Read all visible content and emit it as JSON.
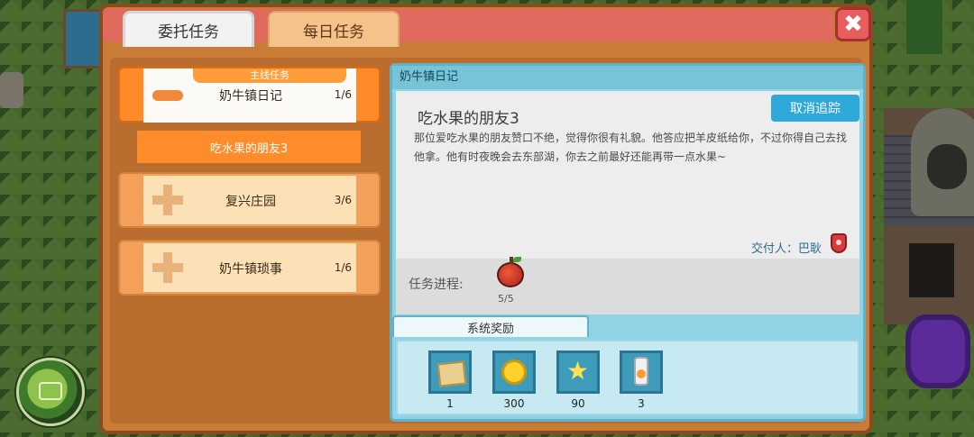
{
  "tabs": {
    "commission": "委托任务",
    "daily": "每日任务"
  },
  "close_label": "✖",
  "quest_list": {
    "main_tag": "主线任务",
    "items": [
      {
        "name": "奶牛镇日记",
        "progress": "1/6"
      },
      {
        "name": "复兴庄园",
        "progress": "3/6"
      },
      {
        "name": "奶牛镇琐事",
        "progress": "1/6"
      }
    ],
    "subquest": "吃水果的朋友3"
  },
  "detail": {
    "header": "奶牛镇日记",
    "title": "吃水果的朋友3",
    "untrack_button": "取消追踪",
    "description": "那位爱吃水果的朋友赞口不绝，觉得你很有礼貌。他答应把羊皮纸给你，不过你得自己去找他拿。他有时夜晚会去东部湖，你去之前最好还能再带一点水果~",
    "deliver_label": "交付人：巴耿",
    "progress_label": "任务进程:",
    "progress_item_count": "5/5",
    "reward_tab": "系统奖励",
    "rewards": [
      {
        "icon": "parchment-icon",
        "value": "1"
      },
      {
        "icon": "coin-icon",
        "value": "300"
      },
      {
        "icon": "star-icon",
        "value": "90"
      },
      {
        "icon": "milk-bottle-icon",
        "value": "3"
      }
    ]
  },
  "colors": {
    "panel": "#c97c38",
    "accent": "#ff8a2a",
    "detail": "#8fd3e5",
    "button": "#2ea8d8"
  }
}
